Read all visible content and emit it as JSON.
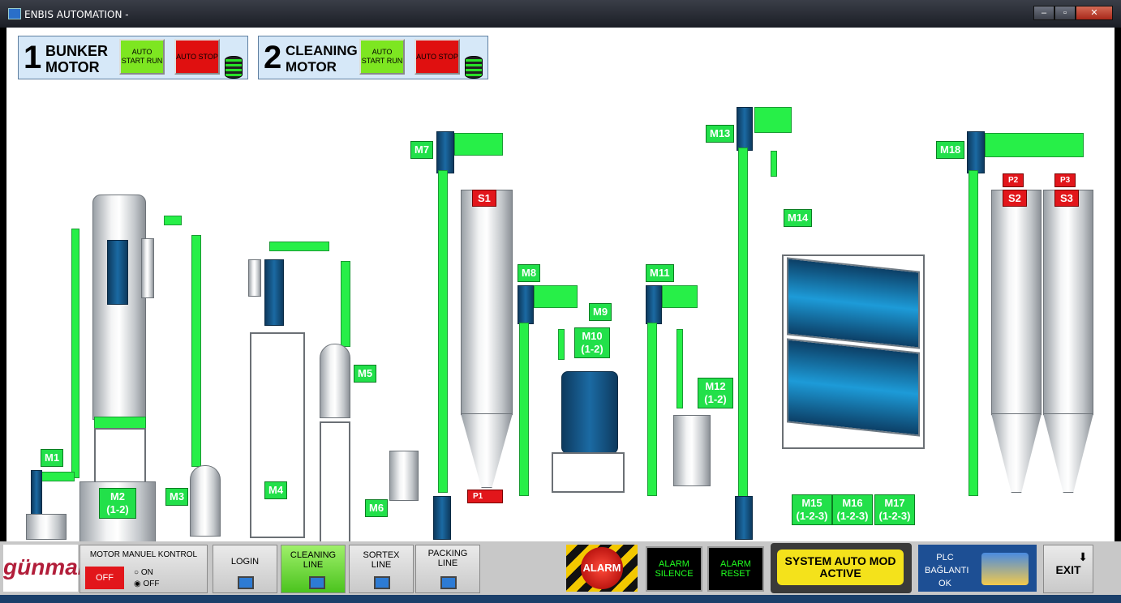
{
  "window": {
    "title": "ENBIS AUTOMATION -"
  },
  "panel1": {
    "number": "1",
    "line1": "BUNKER",
    "line2": "MOTOR",
    "start_label": "AUTO START RUN",
    "stop_label": "AUTO STOP"
  },
  "panel2": {
    "number": "2",
    "line1": "CLEANING",
    "line2": "MOTOR",
    "start_label": "AUTO START RUN",
    "stop_label": "AUTO STOP"
  },
  "motors": {
    "m1": "M1",
    "m2a": "M2",
    "m2b": "(1-2)",
    "m3": "M3",
    "m4": "M4",
    "m5": "M5",
    "m6": "M6",
    "m7": "M7",
    "m8": "M8",
    "m9": "M9",
    "m10a": "M10",
    "m10b": "(1-2)",
    "m11": "M11",
    "m12a": "M12",
    "m12b": "(1-2)",
    "m13": "M13",
    "m14": "M14",
    "m15a": "M15",
    "m15b": "(1-2-3)",
    "m16a": "M16",
    "m16b": "(1-2-3)",
    "m17a": "M17",
    "m17b": "(1-2-3)",
    "m18": "M18"
  },
  "silos": {
    "s1": "S1",
    "s2": "S2",
    "s3": "S3",
    "p1": "P1",
    "p2": "P2",
    "p3": "P3"
  },
  "taskbar": {
    "logo": "günmak",
    "manual_title": "MOTOR MANUEL KONTROL",
    "off_btn": "OFF",
    "radio_on": "ON",
    "radio_off": "OFF",
    "login": "LOGIN",
    "cleaning": "CLEANING LINE",
    "sortex": "SORTEX LINE",
    "packing": "PACKING LINE",
    "alarm": "ALARM",
    "alarm_silence": "ALARM SILENCE",
    "alarm_reset": "ALARM RESET",
    "system_status": "SYSTEM AUTO MOD ACTIVE",
    "plc_line1": "PLC",
    "plc_line2": "BAĞLANTI",
    "plc_line3": "OK",
    "exit": "EXIT"
  },
  "colors": {
    "active_green": "#22e04a",
    "stop_red": "#e2161b",
    "status_yellow": "#f4e21b"
  },
  "icons": [
    "database-icon",
    "monitor-icon",
    "network-icon",
    "exit-arrow-icon"
  ]
}
